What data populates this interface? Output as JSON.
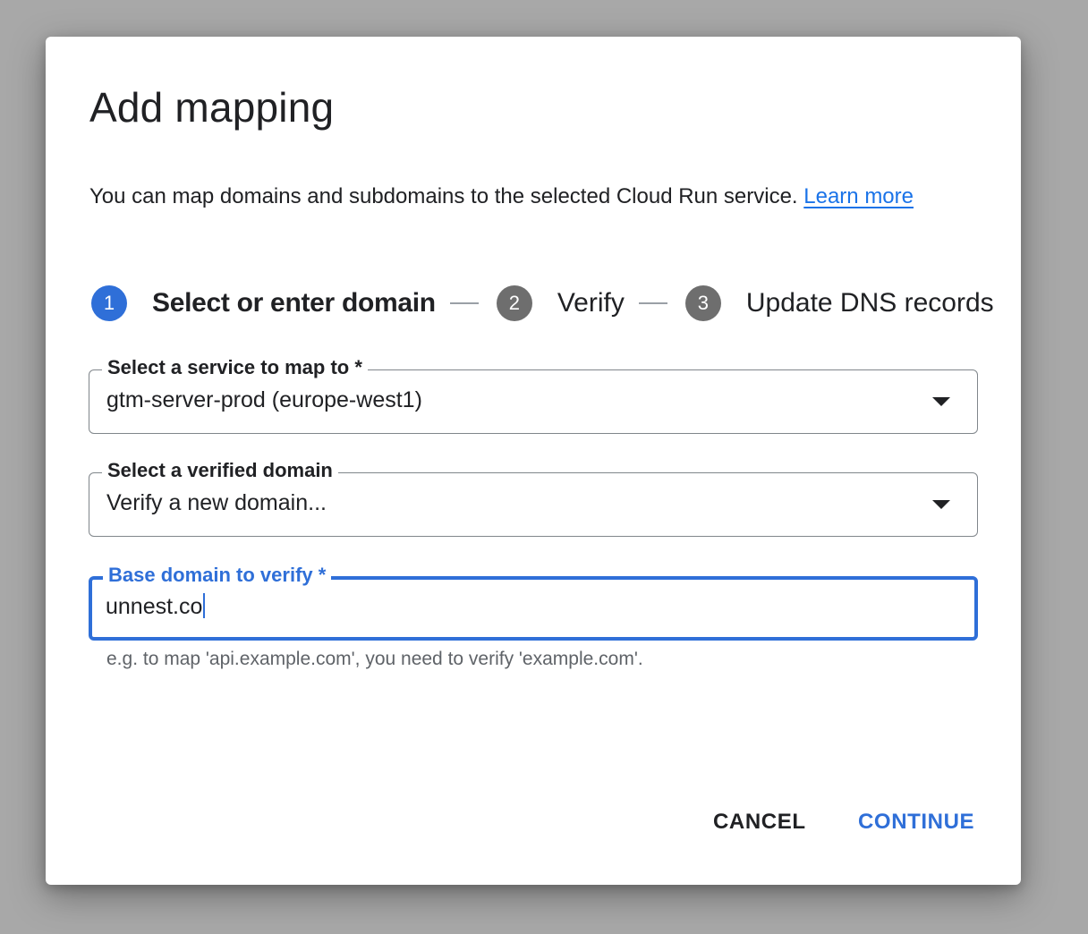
{
  "dialog": {
    "title": "Add mapping",
    "description": "You can map domains and subdomains to the selected Cloud Run service.",
    "learn_more": "Learn more"
  },
  "stepper": {
    "steps": [
      {
        "number": "1",
        "label": "Select or enter domain",
        "active": true
      },
      {
        "number": "2",
        "label": "Verify",
        "active": false
      },
      {
        "number": "3",
        "label": "Update DNS records",
        "active": false
      }
    ]
  },
  "fields": {
    "service": {
      "label": "Select a service to map to *",
      "value": "gtm-server-prod (europe-west1)"
    },
    "verified_domain": {
      "label": "Select a verified domain",
      "value": "Verify a new domain..."
    },
    "base_domain": {
      "label": "Base domain to verify *",
      "value": "unnest.co",
      "hint": "e.g. to map 'api.example.com', you need to verify 'example.com'."
    }
  },
  "actions": {
    "cancel": "CANCEL",
    "continue": "CONTINUE"
  },
  "colors": {
    "accent": "#2f6fd8",
    "link": "#1a73e8",
    "inactive_step": "#6e6e6e",
    "overlay": "#a8a8a8"
  }
}
